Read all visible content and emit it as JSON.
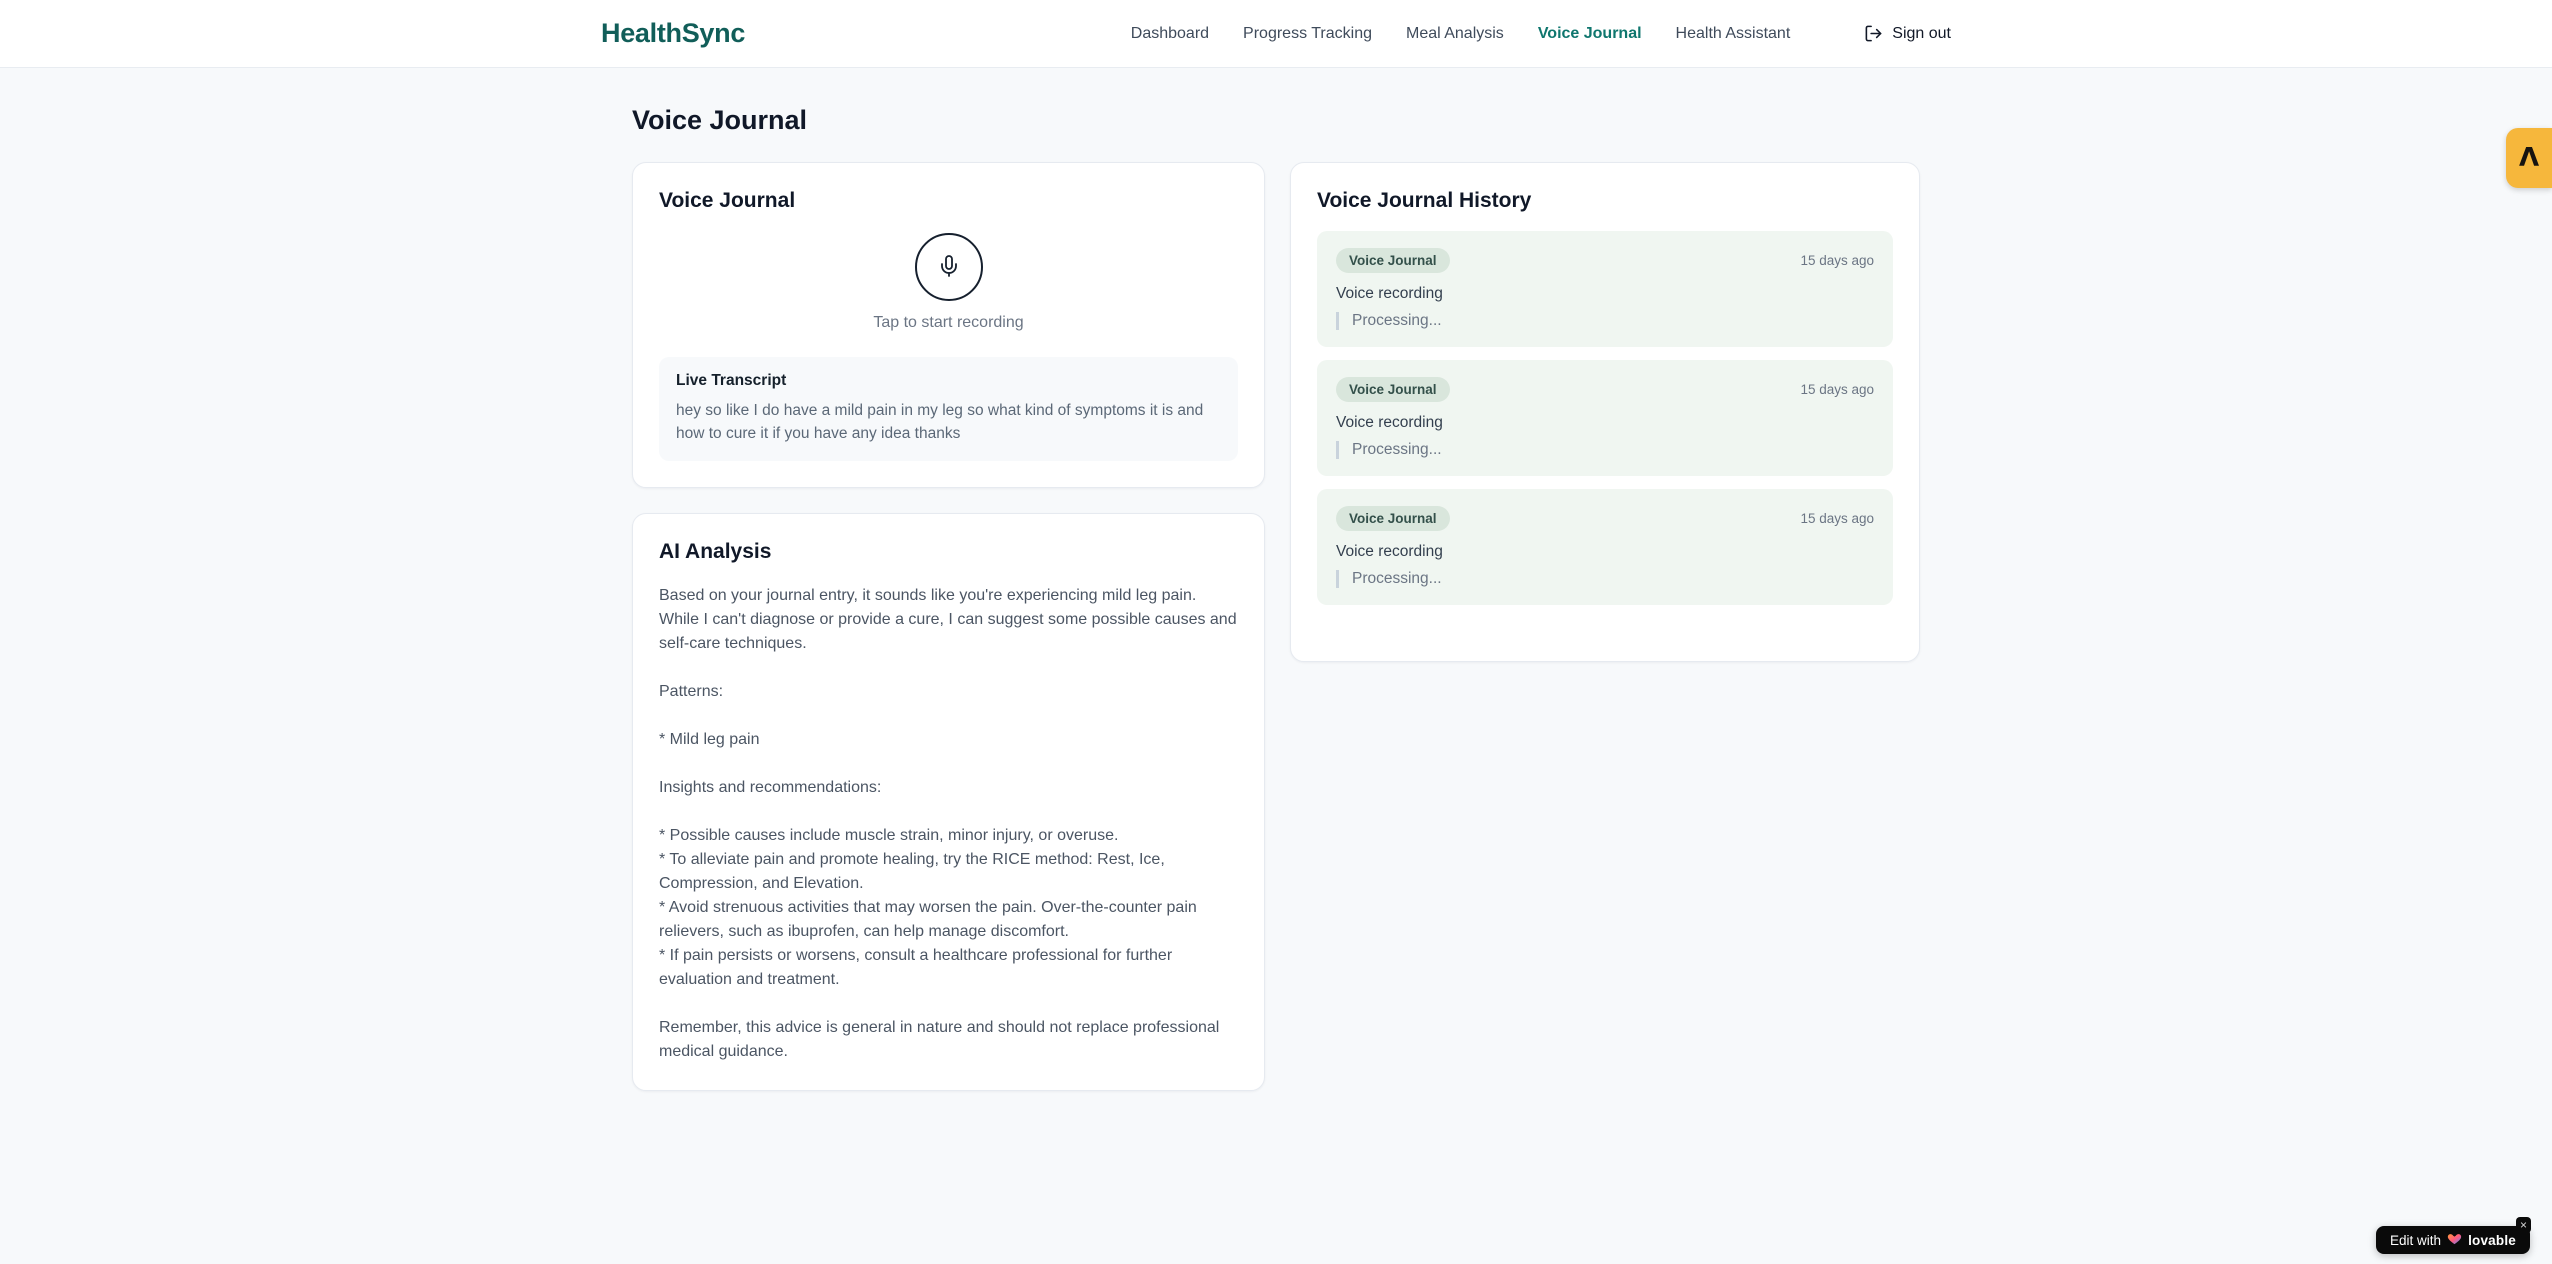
{
  "brand": "HealthSync",
  "nav": {
    "items": [
      {
        "label": "Dashboard",
        "active": false
      },
      {
        "label": "Progress Tracking",
        "active": false
      },
      {
        "label": "Meal Analysis",
        "active": false
      },
      {
        "label": "Voice Journal",
        "active": true
      },
      {
        "label": "Health Assistant",
        "active": false
      }
    ],
    "sign_out_label": "Sign out"
  },
  "page": {
    "title": "Voice Journal"
  },
  "recorder_card": {
    "title": "Voice Journal",
    "tap_label": "Tap to start recording",
    "transcript_title": "Live Transcript",
    "transcript_text": "hey so like I do have a mild pain in my leg so what kind of symptoms it is and how to cure it if you have any idea thanks"
  },
  "analysis_card": {
    "title": "AI Analysis",
    "body": "Based on your journal entry, it sounds like you're experiencing mild leg pain. While I can't diagnose or provide a cure, I can suggest some possible causes and self-care techniques.\n\nPatterns:\n\n* Mild leg pain\n\nInsights and recommendations:\n\n* Possible causes include muscle strain, minor injury, or overuse.\n* To alleviate pain and promote healing, try the RICE method: Rest, Ice, Compression, and Elevation.\n* Avoid strenuous activities that may worsen the pain. Over-the-counter pain relievers, such as ibuprofen, can help manage discomfort.\n* If pain persists or worsens, consult a healthcare professional for further evaluation and treatment.\n\nRemember, this advice is general in nature and should not replace professional medical guidance."
  },
  "history_card": {
    "title": "Voice Journal History",
    "entries": [
      {
        "badge": "Voice Journal",
        "time": "15 days ago",
        "label": "Voice recording",
        "status": "Processing..."
      },
      {
        "badge": "Voice Journal",
        "time": "15 days ago",
        "label": "Voice recording",
        "status": "Processing..."
      },
      {
        "badge": "Voice Journal",
        "time": "15 days ago",
        "label": "Voice recording",
        "status": "Processing..."
      }
    ]
  },
  "overlays": {
    "side_badge_glyph": "Λ",
    "edit_badge_prefix": "Edit with",
    "edit_badge_brand": "lovable",
    "edit_badge_close": "×"
  },
  "colors": {
    "brand_teal": "#115e59",
    "active_nav_teal": "#0f766e",
    "history_entry_bg": "#f0f6f1",
    "badge_bg": "#d9e6dc",
    "side_badge_amber": "#f6b73c",
    "page_bg": "#f7f9fb"
  }
}
